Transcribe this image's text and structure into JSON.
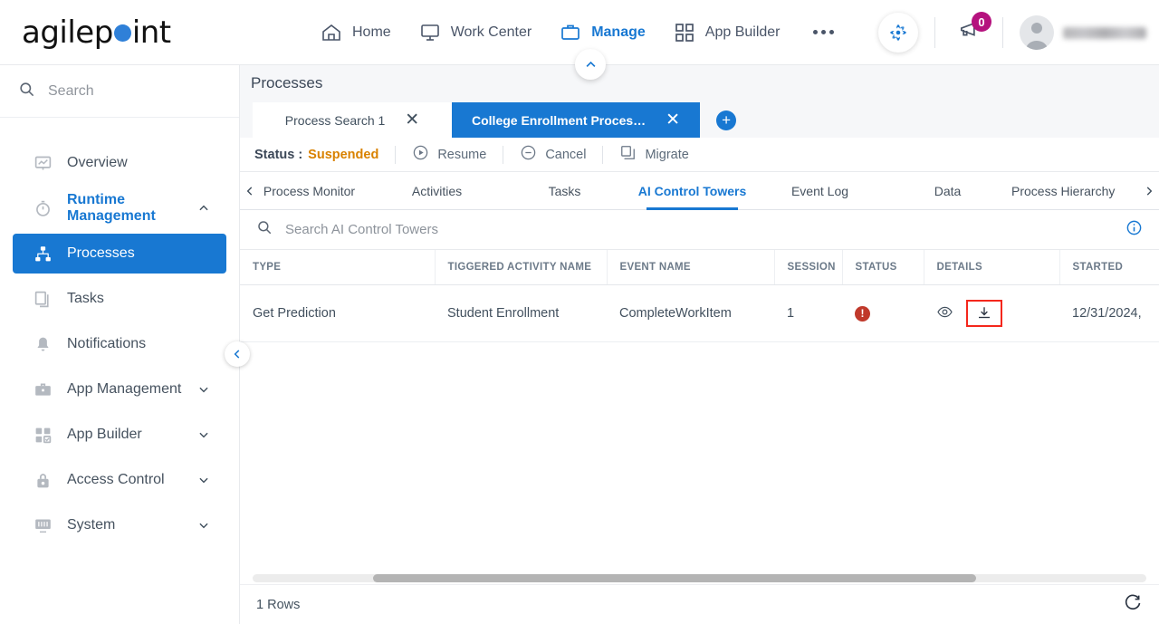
{
  "brand": {
    "name_part1": "agilep",
    "name_part2": "int",
    "dot_color": "#2f80d8"
  },
  "topnav": {
    "items": [
      {
        "label": "Home",
        "icon": "home-icon",
        "active": false
      },
      {
        "label": "Work Center",
        "icon": "monitor-icon",
        "active": false
      },
      {
        "label": "Manage",
        "icon": "briefcase-icon",
        "active": true
      },
      {
        "label": "App Builder",
        "icon": "grid-icon",
        "active": false
      }
    ],
    "more_label": "...",
    "ai_icon": "ai-assistant-icon",
    "announcement_icon": "megaphone-icon",
    "announcement_count": "0",
    "announcement_badge_color": "#b5127e",
    "avatar_icon": "user-avatar-icon"
  },
  "sidebar": {
    "search_placeholder": "Search",
    "items": [
      {
        "label": "Overview",
        "icon": "chart-monitor-icon",
        "state": "normal",
        "chevron": ""
      },
      {
        "label": "Runtime Management",
        "icon": "stopwatch-icon",
        "state": "expanded",
        "chevron": "up"
      },
      {
        "label": "Processes",
        "icon": "process-tree-icon",
        "state": "selected",
        "chevron": ""
      },
      {
        "label": "Tasks",
        "icon": "documents-icon",
        "state": "child",
        "chevron": ""
      },
      {
        "label": "Notifications",
        "icon": "bell-icon",
        "state": "child",
        "chevron": ""
      },
      {
        "label": "App Management",
        "icon": "briefcase-icon",
        "state": "normal",
        "chevron": "down"
      },
      {
        "label": "App Builder",
        "icon": "grid-check-icon",
        "state": "normal",
        "chevron": "down"
      },
      {
        "label": "Access Control",
        "icon": "lock-icon",
        "state": "normal",
        "chevron": "down"
      },
      {
        "label": "System",
        "icon": "system-monitor-icon",
        "state": "normal",
        "chevron": "down"
      }
    ]
  },
  "page": {
    "title": "Processes",
    "tabs": [
      {
        "label": "Process Search 1",
        "active": false
      },
      {
        "label": "College Enrollment Proces…",
        "active": true
      }
    ],
    "add_tab_label": "+"
  },
  "status_toolbar": {
    "status_label": "Status :",
    "status_value": "Suspended",
    "status_color": "#d98200",
    "actions": [
      {
        "label": "Resume",
        "icon": "play-circle-icon"
      },
      {
        "label": "Cancel",
        "icon": "minus-circle-icon"
      },
      {
        "label": "Migrate",
        "icon": "copy-stack-icon"
      }
    ]
  },
  "subtabs": {
    "prev_arrow": "‹",
    "next_arrow": "›",
    "items": [
      {
        "label": "Process Monitor",
        "active": false
      },
      {
        "label": "Activities",
        "active": false
      },
      {
        "label": "Tasks",
        "active": false
      },
      {
        "label": "AI Control Towers",
        "active": true
      },
      {
        "label": "Event Log",
        "active": false
      },
      {
        "label": "Data",
        "active": false
      },
      {
        "label": "Process Hierarchy",
        "active": false
      }
    ]
  },
  "table_search": {
    "placeholder": "Search AI Control Towers",
    "info_icon": "info-circle-icon"
  },
  "table": {
    "columns": [
      "TYPE",
      "TIGGERED ACTIVITY NAME",
      "EVENT NAME",
      "SESSION",
      "STATUS",
      "DETAILS",
      "STARTED"
    ],
    "rows": [
      {
        "type": "Get Prediction",
        "triggered_activity_name": "Student Enrollment",
        "event_name": "CompleteWorkItem",
        "session": "1",
        "status_icon": "error-circle-icon",
        "status_color": "#c0392b",
        "details_view_icon": "eye-icon",
        "details_download_icon": "download-icon",
        "started": "12/31/2024,"
      }
    ]
  },
  "footer": {
    "rows_label": "1 Rows",
    "refresh_icon": "refresh-icon"
  },
  "highlight": {
    "color": "#f4271c",
    "target": "download-icon"
  }
}
